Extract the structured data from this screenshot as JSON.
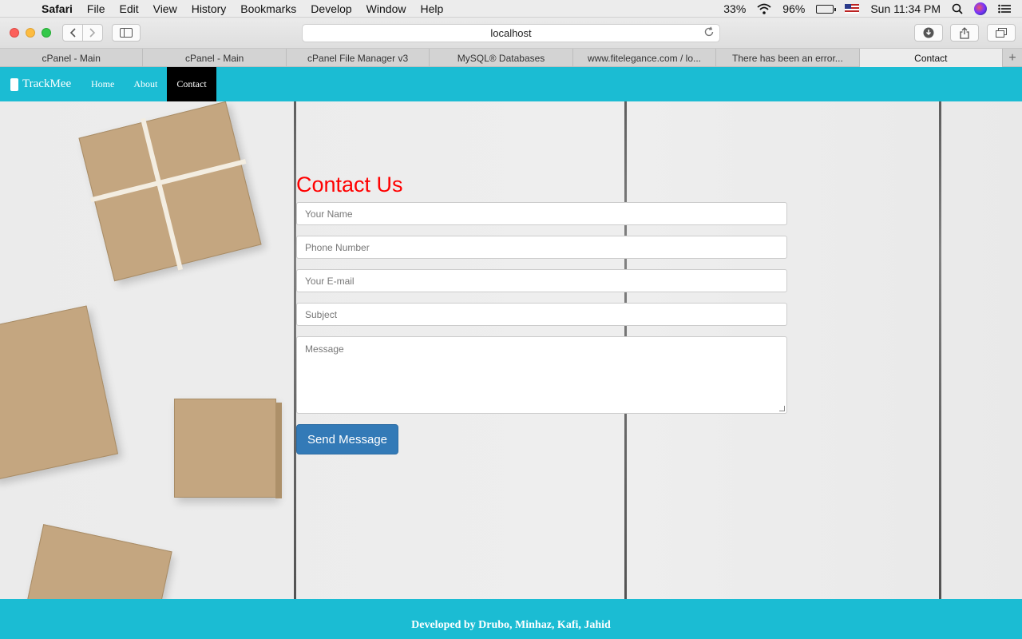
{
  "menubar": {
    "app": "Safari",
    "items": [
      "File",
      "Edit",
      "View",
      "History",
      "Bookmarks",
      "Develop",
      "Window",
      "Help"
    ],
    "status": {
      "cpu": "33%",
      "battery": "96%",
      "clock": "Sun 11:34 PM"
    },
    "icons": [
      "apple-icon",
      "wifi-icon",
      "battery-icon",
      "flag-icon",
      "search-icon",
      "siri-icon",
      "list-icon"
    ]
  },
  "browser": {
    "url": "localhost",
    "tabs": [
      "cPanel - Main",
      "cPanel - Main",
      "cPanel File Manager v3",
      "MySQL® Databases",
      "www.fitelegance.com / lo...",
      "There has been an error...",
      "Contact"
    ],
    "active_tab": "Contact"
  },
  "site": {
    "brand": "TrackMee",
    "nav": [
      "Home",
      "About",
      "Contact"
    ],
    "active_nav": "Contact",
    "accent_color": "#1bbcd3"
  },
  "contact": {
    "title": "Contact Us",
    "title_color": "#ff0000",
    "name_placeholder": "Your Name",
    "phone_placeholder": "Phone Number",
    "email_placeholder": "Your E-mail",
    "subject_placeholder": "Subject",
    "message_placeholder": "Message",
    "submit_label": "Send Message"
  },
  "footer": {
    "text": "Developed by Drubo, Minhaz, Kafi, Jahid"
  }
}
